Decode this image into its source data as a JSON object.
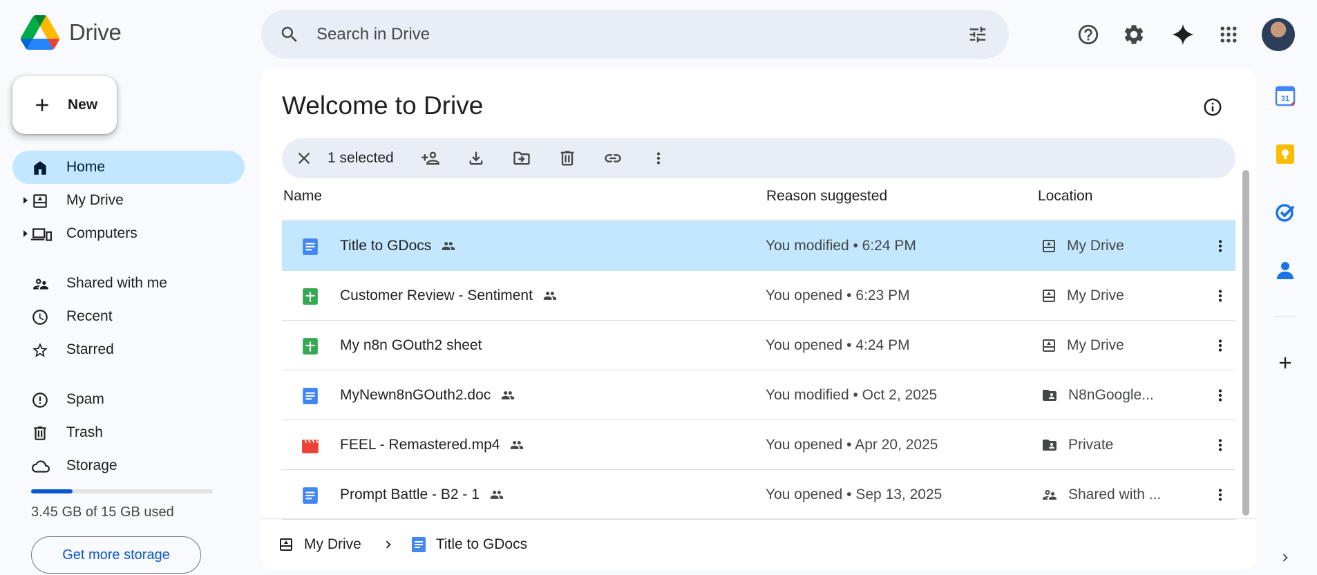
{
  "header": {
    "app_name": "Drive",
    "search_placeholder": "Search in Drive"
  },
  "nav": {
    "new_label": "New",
    "items": [
      {
        "label": "Home",
        "icon": "home-icon",
        "active": true
      },
      {
        "label": "My Drive",
        "icon": "my-drive-icon"
      },
      {
        "label": "Computers",
        "icon": "computers-icon"
      },
      {
        "label": "Shared with me",
        "icon": "shared-icon"
      },
      {
        "label": "Recent",
        "icon": "clock-icon"
      },
      {
        "label": "Starred",
        "icon": "star-icon"
      },
      {
        "label": "Spam",
        "icon": "spam-icon"
      },
      {
        "label": "Trash",
        "icon": "trash-icon"
      },
      {
        "label": "Storage",
        "icon": "cloud-icon"
      }
    ],
    "storage": {
      "used_text": "3.45 GB of 15 GB used",
      "used_fraction": 0.23,
      "button_label": "Get more storage"
    }
  },
  "main": {
    "title": "Welcome to Drive",
    "selection": {
      "count_label": "1 selected"
    },
    "columns": {
      "name": "Name",
      "reason": "Reason suggested",
      "location": "Location"
    },
    "rows": [
      {
        "name": "Title to GDocs",
        "type": "doc",
        "shared": true,
        "reason": "You modified • 6:24 PM",
        "location": "My Drive",
        "location_icon": "my-drive-icon",
        "selected": true
      },
      {
        "name": "Customer Review - Sentiment",
        "type": "sheet",
        "shared": true,
        "reason": "You opened • 6:23 PM",
        "location": "My Drive",
        "location_icon": "my-drive-icon"
      },
      {
        "name": "My n8n GOuth2 sheet",
        "type": "sheet",
        "shared": false,
        "reason": "You opened • 4:24 PM",
        "location": "My Drive",
        "location_icon": "my-drive-icon"
      },
      {
        "name": "MyNewn8nGOuth2.doc",
        "type": "doc",
        "shared": true,
        "reason": "You modified • Oct 2, 2025",
        "location": "N8nGoogle...",
        "location_icon": "shared-folder-icon"
      },
      {
        "name": "FEEL - Remastered.mp4",
        "type": "video",
        "shared": true,
        "reason": "You opened • Apr 20, 2025",
        "location": "Private",
        "location_icon": "shared-folder-icon"
      },
      {
        "name": "Prompt Battle - B2 - 1",
        "type": "doc",
        "shared": true,
        "reason": "You opened • Sep 13, 2025",
        "location": "Shared with ...",
        "location_icon": "shared-icon"
      }
    ],
    "breadcrumb": {
      "root": "My Drive",
      "file": "Title to GDocs"
    }
  },
  "colors": {
    "accent": "#0b57d0",
    "selected_row": "#c2e7ff",
    "doc": "#4285f4",
    "sheet": "#34a853",
    "video": "#ea4335"
  }
}
